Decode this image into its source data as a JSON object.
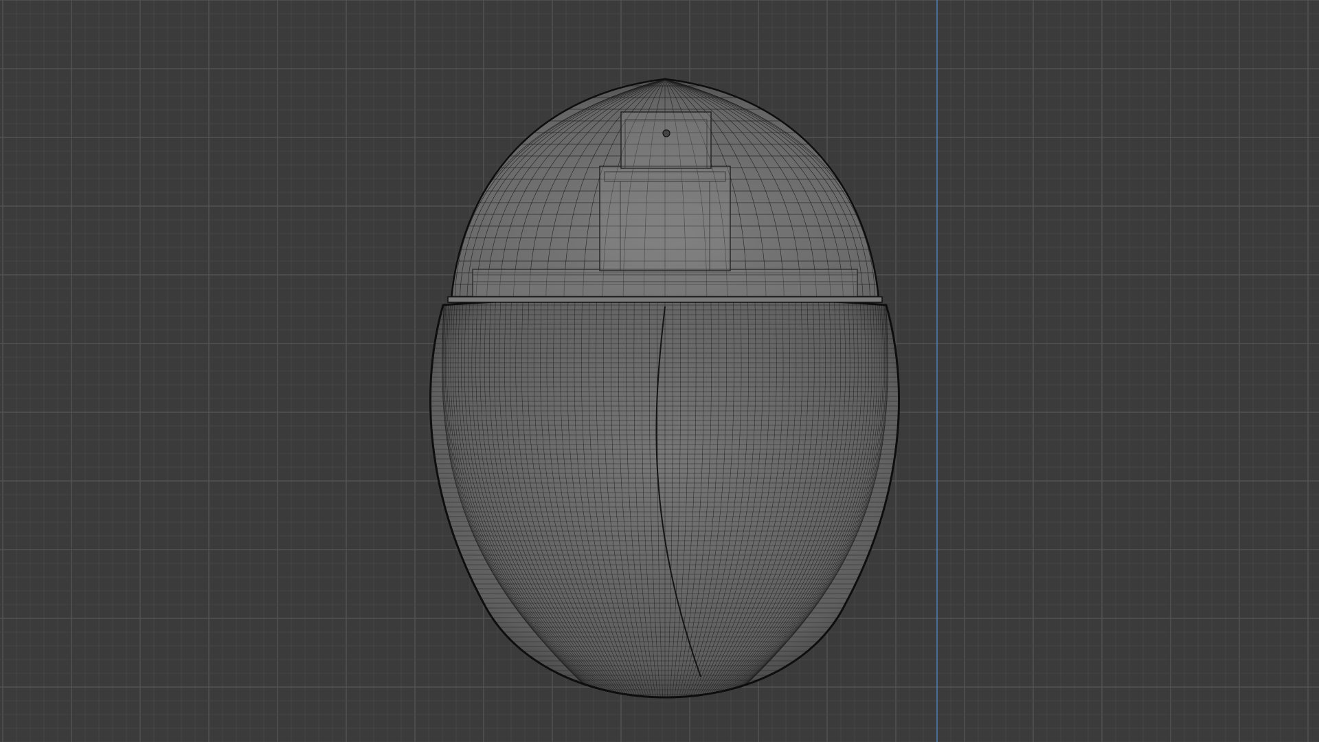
{
  "viewport": {
    "background_color": "#3b3b3b",
    "grid_minor_color": "#4a4a4a",
    "grid_major_color": "#565656",
    "axis_color": "#4f7fb0",
    "grid_visible": true,
    "shading": "wireframe-overlay"
  },
  "model": {
    "object": "egg-shaped-perfume-bottle",
    "parts": [
      "cap-dome",
      "spray-nozzle",
      "neck-collar",
      "bottle-body"
    ],
    "body_color": "#6a6a6a",
    "cap_color": "#767676",
    "wire_color": "#1c1c1c",
    "outline_color": "#0e0e0e"
  }
}
